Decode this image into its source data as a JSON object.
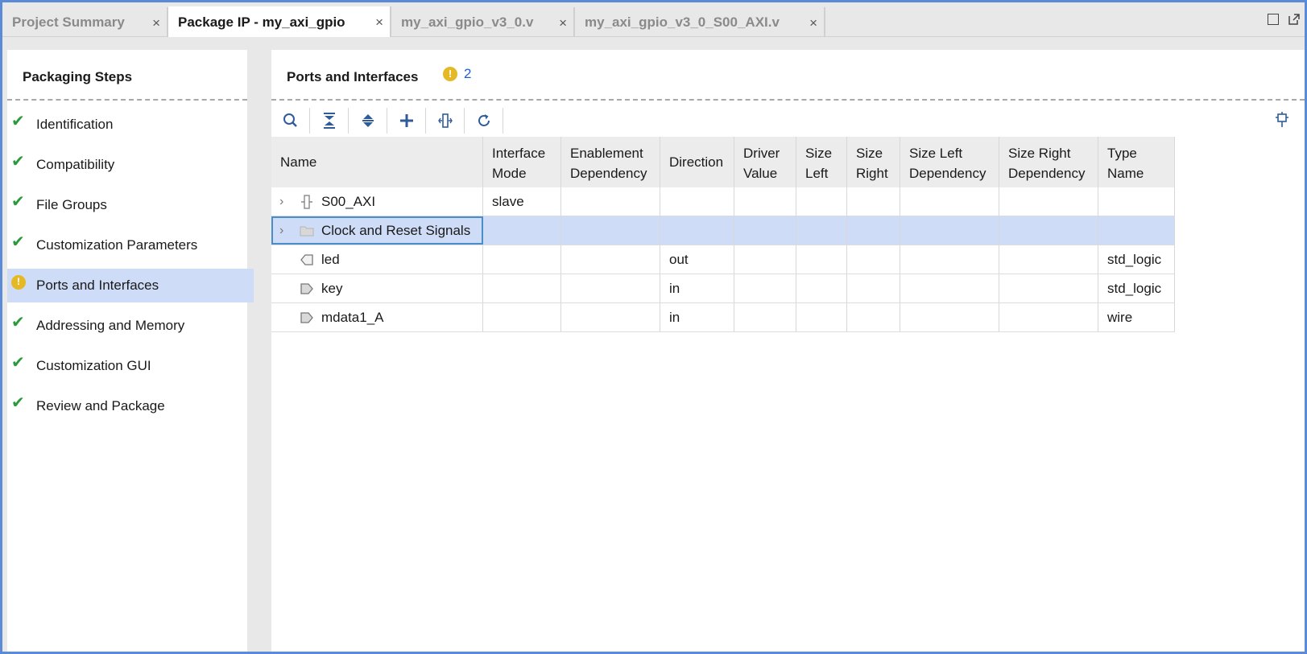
{
  "tabs": [
    {
      "label": "Project Summary",
      "close": "×",
      "active": false
    },
    {
      "label": "Package IP - my_axi_gpio",
      "close": "×",
      "active": true
    },
    {
      "label": "my_axi_gpio_v3_0.v",
      "close": "×",
      "active": false
    },
    {
      "label": "my_axi_gpio_v3_0_S00_AXI.v",
      "close": "×",
      "active": false
    }
  ],
  "steps_panel": {
    "title": "Packaging Steps",
    "steps": [
      {
        "label": "Identification",
        "status": "check"
      },
      {
        "label": "Compatibility",
        "status": "check"
      },
      {
        "label": "File Groups",
        "status": "check"
      },
      {
        "label": "Customization Parameters",
        "status": "check"
      },
      {
        "label": "Ports and Interfaces",
        "status": "warning"
      },
      {
        "label": "Addressing and Memory",
        "status": "check"
      },
      {
        "label": "Customization GUI",
        "status": "check"
      },
      {
        "label": "Review and Package",
        "status": "check"
      }
    ]
  },
  "main": {
    "title": "Ports and Interfaces",
    "warning_count": "2",
    "toolbar_icons": [
      "search-icon",
      "collapse-all-icon",
      "expand-all-icon",
      "add-icon",
      "interface-icon",
      "refresh-icon"
    ],
    "columns": [
      "Name",
      "Interface Mode",
      "Enablement Dependency",
      "Direction",
      "Driver Value",
      "Size Left",
      "Size Right",
      "Size Left Dependency",
      "Size Right Dependency",
      "Type Name"
    ],
    "rows": [
      {
        "name": "S00_AXI",
        "icon": "bus-interface-icon",
        "expandable": true,
        "interface_mode": "slave",
        "direction": "",
        "type_name": ""
      },
      {
        "name": "Clock and Reset Signals",
        "icon": "folder-icon",
        "expandable": true,
        "interface_mode": "",
        "direction": "",
        "type_name": ""
      },
      {
        "name": "led",
        "icon": "output-port-icon",
        "expandable": false,
        "interface_mode": "",
        "direction": "out",
        "type_name": "std_logic"
      },
      {
        "name": "key",
        "icon": "input-port-icon",
        "expandable": false,
        "interface_mode": "",
        "direction": "in",
        "type_name": "std_logic"
      },
      {
        "name": "mdata1_A",
        "icon": "input-port-icon",
        "expandable": false,
        "interface_mode": "",
        "direction": "in",
        "type_name": "wire"
      }
    ]
  },
  "colors": {
    "accent_border": "#5b8ad6",
    "selection": "#cfdcf7",
    "check": "#2a9a3c",
    "warning": "#e5b826",
    "link": "#1f5fcf"
  }
}
